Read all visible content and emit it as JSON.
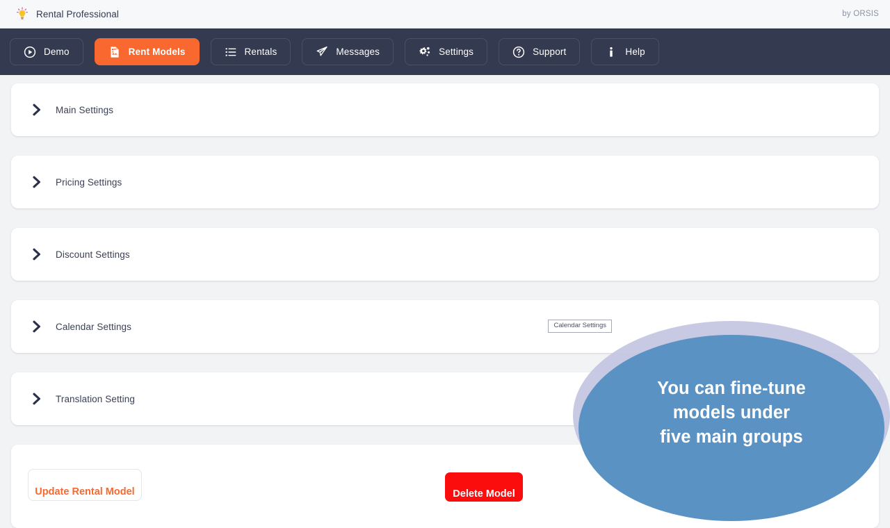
{
  "topbar": {
    "brand_icon": "lightbulb-idea-icon",
    "brand_name": "Rental Professional",
    "credit": "by ORSIS"
  },
  "nav": {
    "active_color": "#f8682f",
    "background": "#343a50",
    "items": [
      {
        "label": "Demo",
        "icon": "play-circle-icon",
        "active": false
      },
      {
        "label": "Rent Models",
        "icon": "file-image-icon",
        "active": true
      },
      {
        "label": "Rentals",
        "icon": "list-ul-icon",
        "active": false
      },
      {
        "label": "Messages",
        "icon": "paper-plane-icon",
        "active": false
      },
      {
        "label": "Settings",
        "icon": "gears-icon",
        "active": false
      },
      {
        "label": "Support",
        "icon": "question-circle-icon",
        "active": false
      },
      {
        "label": "Help",
        "icon": "info-icon",
        "active": false
      }
    ]
  },
  "accordion": {
    "collapse_icon": "chevron-right-icon",
    "sections": [
      {
        "label": "Main Settings",
        "expanded": false,
        "tooltip": null
      },
      {
        "label": "Pricing Settings",
        "expanded": false,
        "tooltip": null
      },
      {
        "label": "Discount Settings",
        "expanded": false,
        "tooltip": null
      },
      {
        "label": "Calendar Settings",
        "expanded": false,
        "tooltip": "Calendar Settings"
      },
      {
        "label": "Translation Setting",
        "expanded": false,
        "tooltip": null
      }
    ]
  },
  "actions": {
    "update_label": "Update Rental Model",
    "delete_label": "Delete Model",
    "update_color": "#f8682f",
    "delete_color": "#fb0d0d"
  },
  "callout": {
    "text": "You can fine-tune\nmodels under\nfive main groups",
    "fill_color": "#5b92c4",
    "halo_color": "#c3c6e2",
    "text_color": "#ffffff"
  },
  "page": {
    "background": "#f2f3f5",
    "card_background": "#ffffff"
  }
}
